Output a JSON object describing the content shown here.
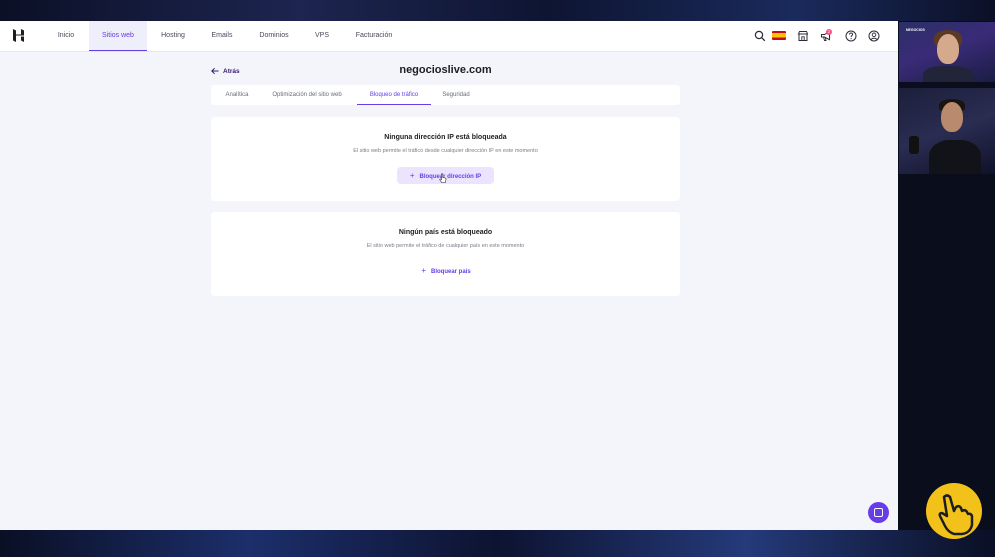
{
  "nav": {
    "items": [
      {
        "label": "Inicio"
      },
      {
        "label": "Sitios web"
      },
      {
        "label": "Hosting"
      },
      {
        "label": "Emails"
      },
      {
        "label": "Dominios"
      },
      {
        "label": "VPS"
      },
      {
        "label": "Facturación"
      }
    ],
    "active": "Sitios web",
    "notification_count": "2",
    "icons": [
      "search-icon",
      "spain-flag-icon",
      "store-icon",
      "megaphone-icon",
      "help-icon",
      "account-icon"
    ]
  },
  "header": {
    "back_label": "Atrás",
    "title": "negocioslive.com"
  },
  "tabs": [
    {
      "label": "Analítica"
    },
    {
      "label": "Optimización del sitio web"
    },
    {
      "label": "Bloqueo de tráfico"
    },
    {
      "label": "Seguridad"
    }
  ],
  "active_tab": "Bloqueo de tráfico",
  "ip_card": {
    "title": "Ninguna dirección IP está bloqueada",
    "description": "El sitio web permite el tráfico desde cualquier dirección IP en este momento",
    "button": "Bloquear dirección IP"
  },
  "country_card": {
    "title": "Ningún país está bloqueado",
    "description": "El sitio web permite el tráfico de cualquier país en este momento",
    "button": "Bloquear país"
  },
  "colors": {
    "accent": "#673de6",
    "accent_light": "#ebe4ff",
    "page_bg": "#f4f4fb",
    "badge": "#fc5185"
  },
  "webcam": {
    "tag": "NEGOCIOS"
  }
}
